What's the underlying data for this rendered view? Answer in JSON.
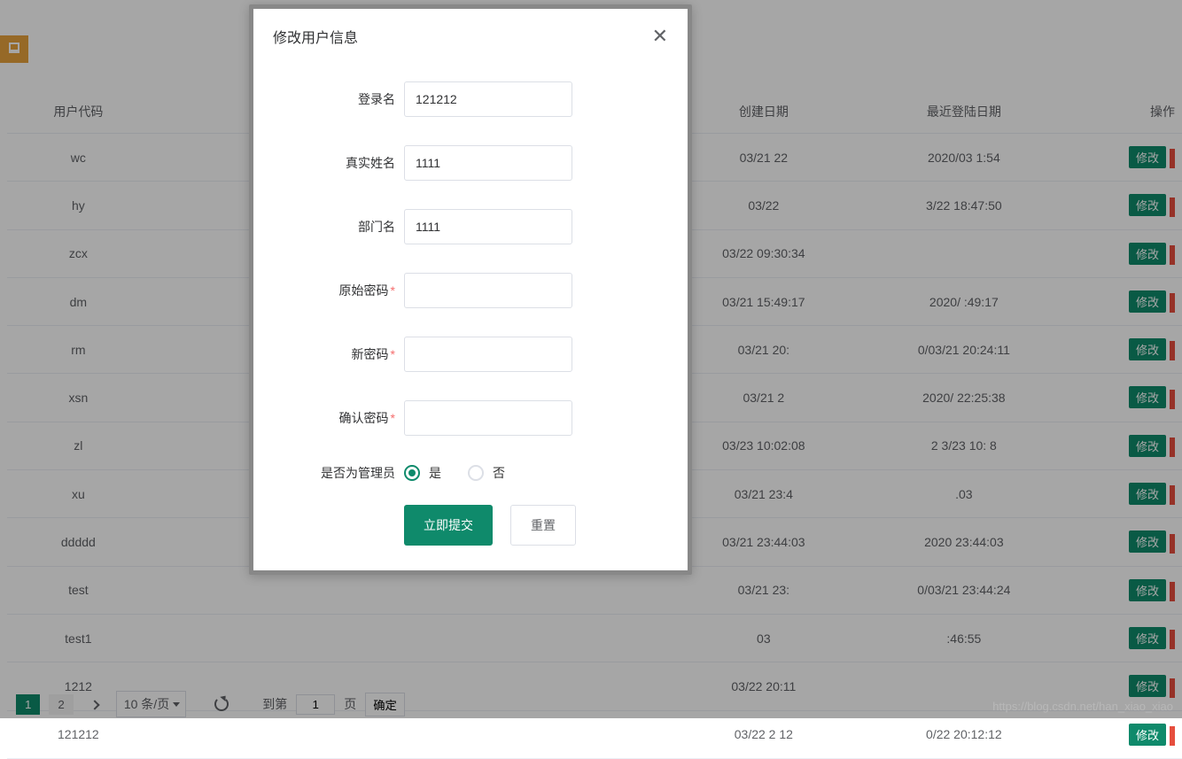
{
  "table": {
    "headers": {
      "code": "用户代码",
      "created": "创建日期",
      "lastlogin": "最近登陆日期",
      "op": "操作"
    },
    "edit_label": "修改",
    "rows": [
      {
        "code": "wc",
        "created": "03/21 22",
        "lastlogin": "2020/03       1:54"
      },
      {
        "code": "hy",
        "created": "03/22",
        "lastlogin": "3/22 18:47:50"
      },
      {
        "code": "zcx",
        "created": "03/22 09:30:34",
        "lastlogin": ""
      },
      {
        "code": "dm",
        "created": "03/21 15:49:17",
        "lastlogin": "2020/     :49:17"
      },
      {
        "code": "rm",
        "created": "03/21 20:",
        "lastlogin": "0/03/21 20:24:11"
      },
      {
        "code": "xsn",
        "created": "03/21 2",
        "lastlogin": "2020/   22:25:38"
      },
      {
        "code": "zl",
        "created": "03/23 10:02:08",
        "lastlogin": "2   3/23 10:   8"
      },
      {
        "code": "xu",
        "created": "03/21 23:4",
        "lastlogin": "            .03"
      },
      {
        "code": "ddddd",
        "created": "03/21 23:44:03",
        "lastlogin": "2020     23:44:03"
      },
      {
        "code": "test",
        "created": "03/21 23:",
        "lastlogin": "0/03/21 23:44:24"
      },
      {
        "code": "test1",
        "created": "03",
        "lastlogin": "       :46:55"
      },
      {
        "code": "1212",
        "created": "03/22 20:11",
        "lastlogin": ""
      },
      {
        "code": "121212",
        "created": "03/22 2   12",
        "lastlogin": "0/22 20:12:12"
      }
    ]
  },
  "pager": {
    "page1": "1",
    "page2": "2",
    "page_size": "10 条/页",
    "goto_label": "到第",
    "goto_value": "1",
    "page_unit": "页",
    "confirm": "确定"
  },
  "modal": {
    "title": "修改用户信息",
    "labels": {
      "login": "登录名",
      "realname": "真实姓名",
      "dept": "部门名",
      "origpw": "原始密码",
      "newpw": "新密码",
      "confirmpw": "确认密码",
      "isadmin": "是否为管理员"
    },
    "values": {
      "login": "121212",
      "realname": "1111",
      "dept": "1111",
      "origpw": "",
      "newpw": "",
      "confirmpw": ""
    },
    "radio": {
      "yes": "是",
      "no": "否",
      "selected": "yes"
    },
    "buttons": {
      "submit": "立即提交",
      "reset": "重置"
    }
  },
  "watermark": "https://blog.csdn.net/han_xiao_xiao"
}
